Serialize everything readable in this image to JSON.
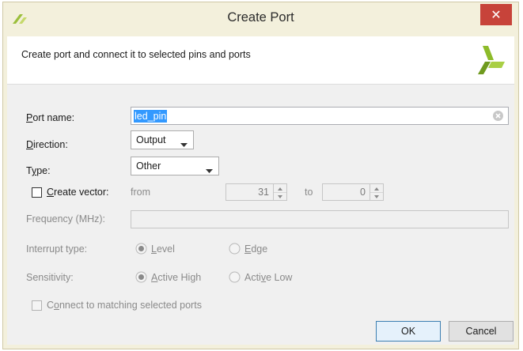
{
  "window": {
    "title": "Create Port",
    "close_label": "✕"
  },
  "header": {
    "description": "Create port and connect it to selected pins and ports"
  },
  "form": {
    "port_name": {
      "label_underlined": "P",
      "label_rest": "ort name:",
      "value": "led_pin"
    },
    "direction": {
      "label_underlined": "D",
      "label_rest": "irection:",
      "value": "Output"
    },
    "type": {
      "label_pre": "T",
      "label_underlined": "y",
      "label_rest": "pe:",
      "value": "Other"
    },
    "create_vector": {
      "label_underlined": "C",
      "label_rest": "reate vector:",
      "checked": false,
      "from_label": "from",
      "from_value": "31",
      "to_label": "to",
      "to_value": "0"
    },
    "frequency": {
      "label": "Frequency (MHz):",
      "value": ""
    },
    "interrupt_type": {
      "label": "Interrupt type:",
      "options": [
        {
          "underlined": "L",
          "rest": "evel",
          "selected": true
        },
        {
          "underlined": "E",
          "rest": "dge",
          "selected": false
        }
      ]
    },
    "sensitivity": {
      "label": "Sensitivity:",
      "options": [
        {
          "underlined": "A",
          "rest": "ctive High",
          "selected": true
        },
        {
          "pre": "Acti",
          "underlined": "v",
          "rest": "e Low",
          "selected": false
        }
      ]
    },
    "connect_matching": {
      "label_pre": "C",
      "label_underlined": "o",
      "label_rest": "nnect to matching selected ports",
      "checked": false
    }
  },
  "buttons": {
    "ok": "OK",
    "cancel": "Cancel"
  },
  "colors": {
    "selection": "#3399ff",
    "close": "#c7433a",
    "frame": "#f3f0dc"
  }
}
